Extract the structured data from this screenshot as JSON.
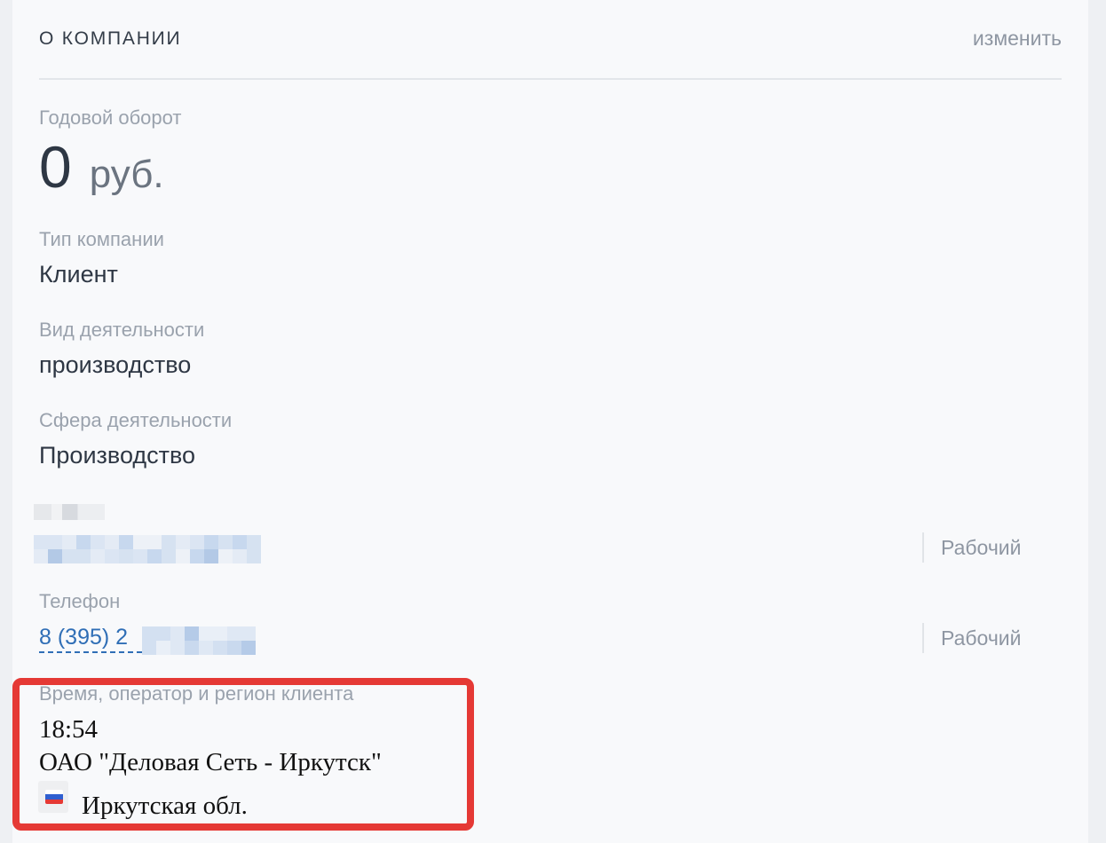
{
  "header": {
    "title": "О КОМПАНИИ",
    "edit_label": "изменить"
  },
  "revenue": {
    "label": "Годовой оборот",
    "value": "0",
    "currency": "руб."
  },
  "company_type": {
    "label": "Тип компании",
    "value": "Клиент"
  },
  "activity_kind": {
    "label": "Вид деятельности",
    "value": "производство"
  },
  "activity_sphere": {
    "label": "Сфера деятельности",
    "value": "Производство"
  },
  "email": {
    "tag": "Рабочий"
  },
  "phone": {
    "label": "Телефон",
    "value_visible": "8 (395) 2",
    "tag": "Рабочий"
  },
  "client_info": {
    "label": "Время, оператор и регион клиента",
    "time": "18:54",
    "operator": "ОАО \"Деловая Сеть - Иркутск\"",
    "region": "Иркутская обл.",
    "flag_colors": [
      "#ffffff",
      "#2f5fd0",
      "#e53935"
    ]
  },
  "colors": {
    "link": "#2f6eb6",
    "highlight_border": "#e53935"
  }
}
